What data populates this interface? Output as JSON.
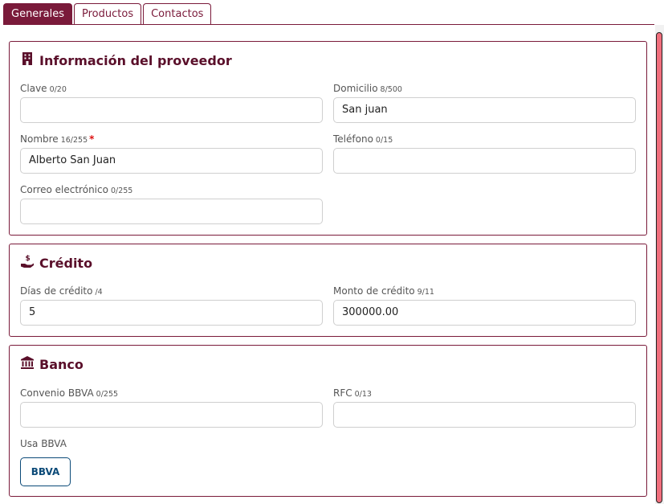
{
  "tabs": [
    {
      "label": "Generales",
      "active": true
    },
    {
      "label": "Productos",
      "active": false
    },
    {
      "label": "Contactos",
      "active": false
    }
  ],
  "colors": {
    "accent": "#7a1a3a",
    "title": "#5a0f2a",
    "bbva": "#0b4a78",
    "scrollbar": "#f16f7d"
  },
  "provider": {
    "title": "Información del proveedor",
    "icon": "building-icon",
    "clave": {
      "label": "Clave",
      "count": "0/20",
      "value": ""
    },
    "domicilio": {
      "label": "Domicilio",
      "count": "8/500",
      "value": "San juan"
    },
    "nombre": {
      "label": "Nombre",
      "count": "16/255",
      "required": "*",
      "value": "Alberto San Juan"
    },
    "telefono": {
      "label": "Teléfono",
      "count": "0/15",
      "value": ""
    },
    "correo": {
      "label": "Correo electrónico",
      "count": "0/255",
      "value": ""
    }
  },
  "credit": {
    "title": "Crédito",
    "icon": "hand-dollar-icon",
    "dias": {
      "label": "Días de crédito",
      "count": "/4",
      "value": "5"
    },
    "monto": {
      "label": "Monto de crédito",
      "count": "9/11",
      "value": "300000.00"
    }
  },
  "bank": {
    "title": "Banco",
    "icon": "bank-icon",
    "convenio": {
      "label": "Convenio BBVA",
      "count": "0/255",
      "value": ""
    },
    "rfc": {
      "label": "RFC",
      "count": "0/13",
      "value": ""
    },
    "usa_bbva": {
      "label": "Usa BBVA",
      "button": "BBVA"
    }
  }
}
